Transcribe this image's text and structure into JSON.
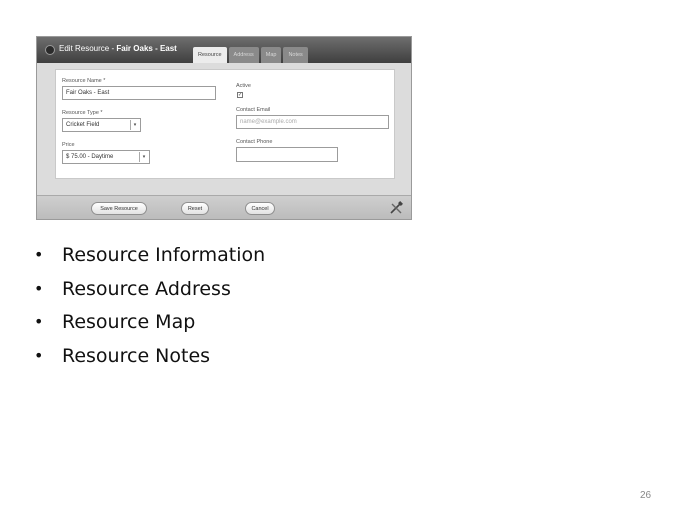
{
  "dialog": {
    "title_prefix": "Edit Resource -",
    "title_name": "Fair Oaks - East",
    "tabs": [
      "Resource",
      "Address",
      "Map",
      "Notes"
    ],
    "form": {
      "resource_name": {
        "label": "Resource Name *",
        "value": "Fair Oaks - East"
      },
      "resource_type": {
        "label": "Resource Type *",
        "value": "Cricket Field"
      },
      "price": {
        "label": "Price",
        "value": "$ 75.00 - Daytime"
      },
      "active": {
        "label": "Active",
        "checked_glyph": "✓"
      },
      "contact_email": {
        "label": "Contact Email",
        "placeholder": "name@example.com"
      },
      "contact_phone": {
        "label": "Contact Phone",
        "value": ""
      }
    },
    "footer": {
      "save_label": "Save Resource",
      "reset_label": "Reset",
      "cancel_label": "Cancel",
      "tools_icon": "tools-icon"
    }
  },
  "bullets": [
    "Resource Information",
    "Resource Address",
    "Resource Map",
    "Resource Notes"
  ],
  "bullet_glyph": "•",
  "page_number": "26"
}
